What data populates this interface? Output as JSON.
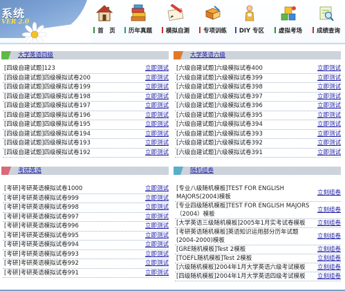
{
  "brand": {
    "title": "系统",
    "subtitle": "VER 2.0"
  },
  "nav": [
    {
      "label": "首　页",
      "icon": "house-icon",
      "color": "#2e8b3a"
    },
    {
      "label": "历年真题",
      "icon": "books-icon",
      "color": "#1f9a8a"
    },
    {
      "label": "模拟自测",
      "icon": "pencil-paper-icon",
      "color": "#c03030"
    },
    {
      "label": "专项训练",
      "icon": "notebook-icon",
      "color": "#c03030"
    },
    {
      "label": "DIY 专区",
      "icon": "person-icon",
      "color": "#3a4aa0"
    },
    {
      "label": "虚拟考场",
      "icon": "blocks-icon",
      "color": "#2e8b3a"
    },
    {
      "label": "成绩查询",
      "icon": "magnifier-icon",
      "color": "#c03030"
    }
  ],
  "link_label": "立即测试",
  "random_link_label": "立刻组卷",
  "panels": {
    "cet4": {
      "title": "大学英语四级",
      "accent": "#5fb84a",
      "items": [
        "[四级自建试题]123",
        "[四级自建试题]四级模拟试卷200",
        "[四级自建试题]四级模拟试卷199",
        "[四级自建试题]四级模拟试卷198",
        "[四级自建试题]四级模拟试卷197",
        "[四级自建试题]四级模拟试卷196",
        "[四级自建试题]四级模拟试卷195",
        "[四级自建试题]四级模拟试卷194",
        "[四级自建试题]四级模拟试卷193",
        "[四级自建试题]四级模拟试卷192"
      ]
    },
    "cet6": {
      "title": "大学英语六级",
      "accent": "#e07a2a",
      "items": [
        "[六级自建试题]六级模拟试卷400",
        "[六级自建试题]六级模拟试卷399",
        "[六级自建试题]六级模拟试卷398",
        "[六级自建试题]六级模拟试卷397",
        "[六级自建试题]六级模拟试卷396",
        "[六级自建试题]六级模拟试卷395",
        "[六级自建试题]六级模拟试卷394",
        "[六级自建试题]六级模拟试卷393",
        "[六级自建试题]六级模拟试卷392",
        "[六级自建试题]六级模拟试卷391"
      ]
    },
    "kaoyan": {
      "title": "考研英语",
      "accent": "#d86a7a",
      "items": [
        "[考研]考研英语模拟试卷1000",
        "[考研]考研英语模拟试卷999",
        "[考研]考研英语模拟试卷998",
        "[考研]考研英语模拟试卷997",
        "[考研]考研英语模拟试卷996",
        "[考研]考研英语模拟试卷995",
        "[考研]考研英语模拟试卷994",
        "[考研]考研英语模拟试卷993",
        "[考研]考研英语模拟试卷992",
        "[考研]考研英语模拟试卷991"
      ]
    },
    "random": {
      "title": "随机组卷",
      "accent": "#5aaec8",
      "items": [
        "[专业八级随机模板]TEST FOR ENGLISH MAJORS(2004)模板",
        "[专业四级随机模板]TEST FOR ENGLISH MAJORS（2004）模板",
        "[大学英语三级随机模板]2005年1月实考试卷模板",
        "[考研英语随机模板]英语知识运用部分历年试题(2004-2000)模板",
        "[GRE随机模板]Test 2模板",
        "[TOEFL随机模板]Test 2模板",
        "[六级随机模板]2004年1月大学英语六级考试模板",
        "[四级随机模板]2004年1月大学英语四级考试模板"
      ]
    }
  }
}
